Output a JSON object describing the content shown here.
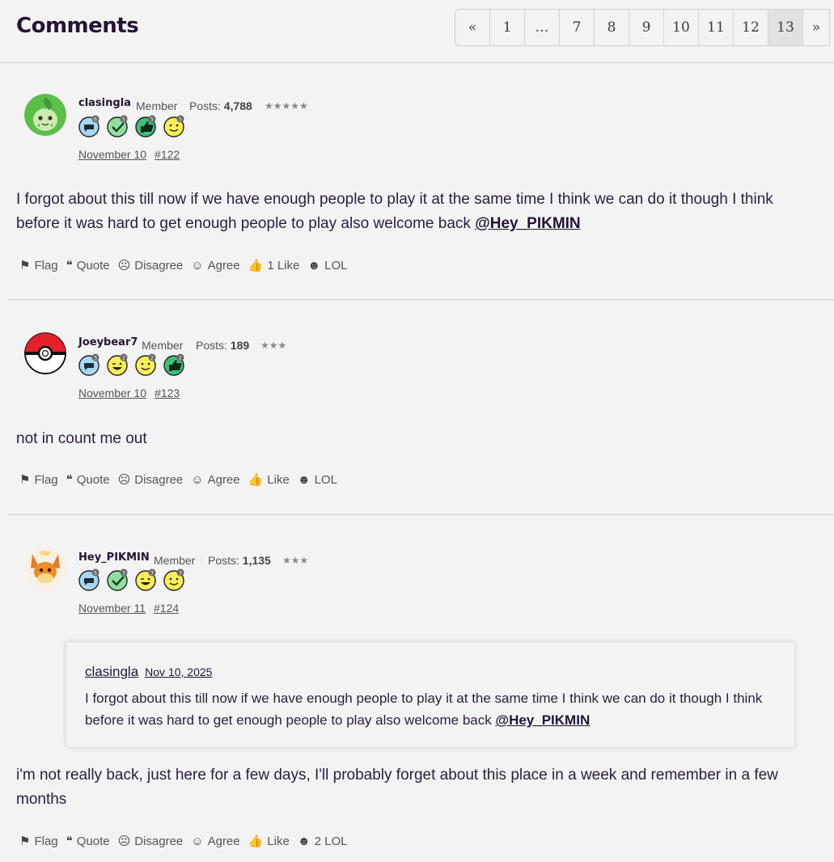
{
  "header": {
    "title": "Comments",
    "pager": [
      "«",
      "1",
      "…",
      "7",
      "8",
      "9",
      "10",
      "11",
      "12",
      "13",
      "»"
    ],
    "current_page": "13"
  },
  "comments": [
    {
      "username": "clasingla",
      "role": "Member",
      "posts_label": "Posts:",
      "posts": "4,788",
      "stars": "★★★★★",
      "badge_counts": [
        "6",
        "5",
        "5",
        "5"
      ],
      "date": "November 10",
      "number": "#122",
      "text": "I forgot about this till now if we have enough people to play it at the same time I think we can do it though I think before it was hard to get enough people to play also welcome back ",
      "mention": "@Hey_PIKMIN",
      "reactions": {
        "flag": "Flag",
        "quote": "Quote",
        "disagree": "Disagree",
        "agree": "Agree",
        "like": "1 Like",
        "lol": "LOL"
      }
    },
    {
      "username": "Joeybear7",
      "role": "Member",
      "posts_label": "Posts:",
      "posts": "189",
      "stars": "★★★",
      "badge_counts": [
        "3",
        "2",
        "2",
        "2"
      ],
      "date": "November 10",
      "number": "#123",
      "text": "not in count me out",
      "reactions": {
        "flag": "Flag",
        "quote": "Quote",
        "disagree": "Disagree",
        "agree": "Agree",
        "like": "Like",
        "lol": "LOL"
      }
    },
    {
      "username": "Hey_PIKMIN",
      "role": "Member",
      "posts_label": "Posts:",
      "posts": "1,135",
      "stars": "★★★",
      "badge_counts": [
        "5",
        "3",
        "3",
        "3"
      ],
      "date": "November 11",
      "number": "#124",
      "quote": {
        "author": "clasingla",
        "date": "Nov 10, 2025",
        "text": "I forgot about this till now if we have enough people to play it at the same time I think we can do it though I think before it was hard to get enough people to play also welcome back ",
        "mention": "@Hey_PIKMIN"
      },
      "text": "i'm not really back, just here for a few days, I'll probably forget about this place in a week and remember in a few months",
      "reactions": {
        "flag": "Flag",
        "quote": "Quote",
        "disagree": "Disagree",
        "agree": "Agree",
        "like": "Like",
        "lol": "2 LOL"
      }
    }
  ],
  "colors": {
    "accent": "#231435",
    "text": "#2b1f3d",
    "background": "#f3f3f3"
  }
}
